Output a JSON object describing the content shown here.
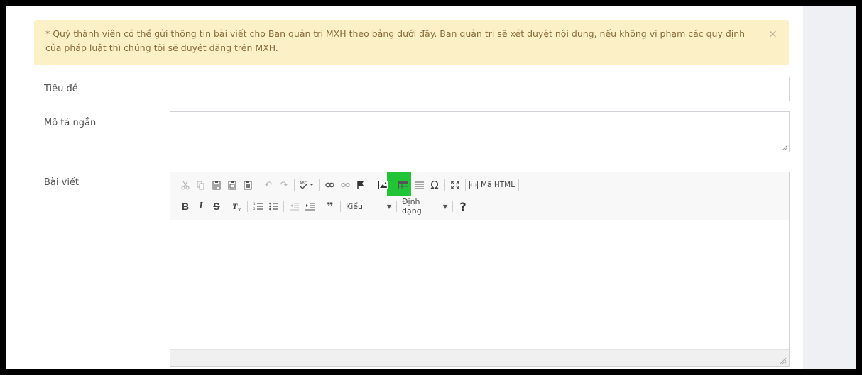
{
  "alert": {
    "message": "* Quý thành viên có thể gửi thông tin bài viết cho Ban quản trị MXH theo bảng dưới đây. Ban quản trị sẽ xét duyệt nội dung, nếu không vi phạm các quy định của pháp luật thì chúng tôi sẽ duyệt đăng trên MXH.",
    "close": "×"
  },
  "form": {
    "title_label": "Tiêu đề",
    "title_value": "",
    "desc_label": "Mô tả ngắn",
    "desc_value": "",
    "body_label": "Bài viết"
  },
  "editor": {
    "toolbar_row1": [
      {
        "name": "cut-icon"
      },
      {
        "name": "copy-icon"
      },
      {
        "name": "paste-icon"
      },
      {
        "name": "paste-text-icon"
      },
      {
        "name": "paste-word-icon"
      },
      {
        "name": "undo-icon"
      },
      {
        "name": "redo-icon"
      },
      {
        "name": "spellcheck-icon"
      },
      {
        "name": "link-icon"
      },
      {
        "name": "unlink-icon"
      },
      {
        "name": "anchor-icon"
      },
      {
        "name": "image-icon"
      },
      {
        "name": "table-icon"
      },
      {
        "name": "horizontal-rule-icon"
      },
      {
        "name": "special-char-icon"
      },
      {
        "name": "maximize-icon"
      },
      {
        "name": "source-icon"
      }
    ],
    "source_label": "Mã HTML",
    "bold": "B",
    "italic": "I",
    "strike": "S",
    "styles_label": "Kiểu",
    "format_label": "Định dạng",
    "help": "?",
    "highlight_color": "#21c337"
  }
}
